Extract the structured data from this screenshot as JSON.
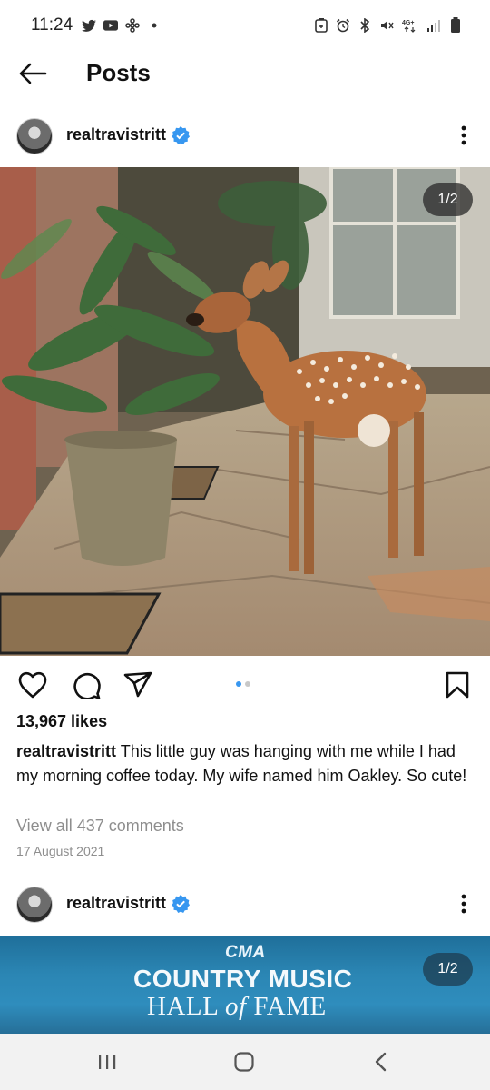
{
  "status_bar": {
    "time": "11:24",
    "left_icons": [
      "twitter-icon",
      "youtube-icon",
      "pinwheel-icon",
      "dot-icon"
    ],
    "right_icons": [
      "battery-saver-icon",
      "alarm-icon",
      "bluetooth-icon",
      "mute-icon",
      "network-4g-icon",
      "signal-icon",
      "battery-icon"
    ],
    "network_label": "4G+"
  },
  "header": {
    "title": "Posts",
    "back_icon": "back-arrow-icon"
  },
  "posts": [
    {
      "username": "realtravistritt",
      "verified": true,
      "image_counter": "1/2",
      "image_description_icon": "photo",
      "likes": "13,967 likes",
      "caption_user": "realtravistritt",
      "caption_text": "This little guy was hanging with me while I had my morning coffee today. My wife named him Oakley. So cute!",
      "view_comments": "View all 437 comments",
      "date": "17 August 2021",
      "carousel_index": 0,
      "carousel_count": 2
    },
    {
      "username": "realtravistritt",
      "verified": true,
      "image_counter": "1/2",
      "image_text": {
        "logo": "CMA",
        "line1": "COUNTRY MUSIC",
        "line2_a": "HALL ",
        "line2_of": "of",
        "line2_b": " FAME"
      }
    }
  ],
  "colors": {
    "accent_blue": "#3897f0",
    "verified_blue": "#3797f0",
    "secondary_text": "#8e8e8e",
    "nav_bg": "#f2f2f2"
  },
  "nav_bar": {
    "icons": [
      "recent-apps-icon",
      "home-icon",
      "back-icon"
    ]
  }
}
